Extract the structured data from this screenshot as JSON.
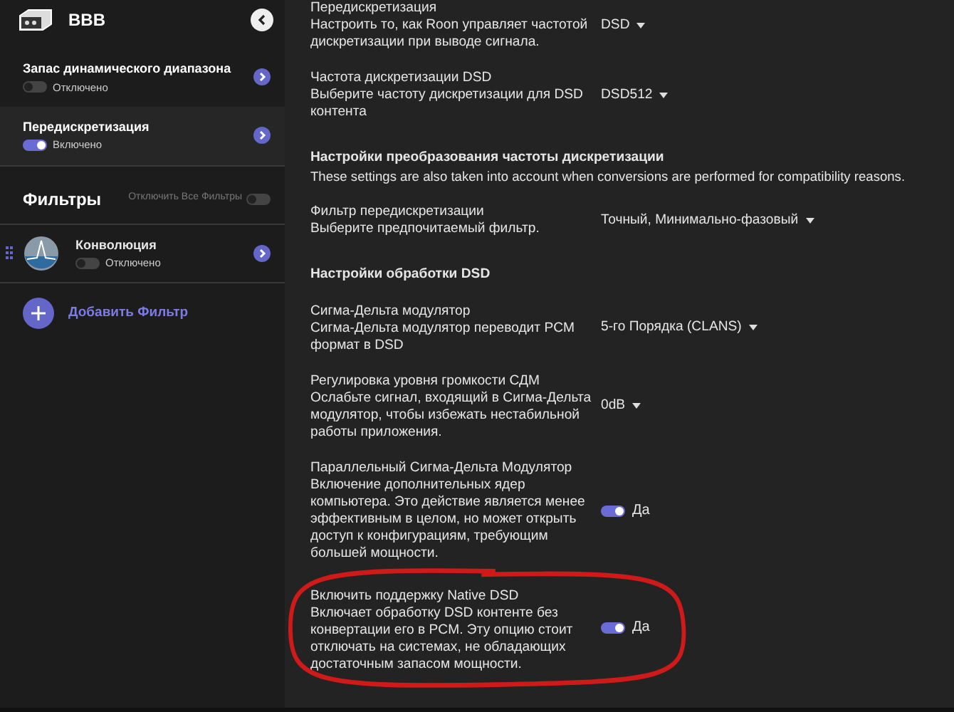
{
  "sidebar": {
    "device": {
      "title": "BBB"
    },
    "items": [
      {
        "title": "Запас динамического диапазона",
        "status": "Отключено",
        "on": false,
        "selected": false
      },
      {
        "title": "Передискретизация",
        "status": "Включено",
        "on": true,
        "selected": true
      }
    ],
    "filters": {
      "heading": "Фильтры",
      "disable_all_label": "Отключить Все Фильтры",
      "disable_all_on": false,
      "items": [
        {
          "title": "Конволюция",
          "status": "Отключено",
          "on": false
        }
      ],
      "add_label": "Добавить Фильтр"
    }
  },
  "settings": [
    {
      "kind": "select",
      "title": "Передискретизация",
      "description": "Настроить то, как Roon управляет частотой дискретизации при выводе сигнала.",
      "value": "DSD",
      "highlighted": false
    },
    {
      "kind": "select",
      "title": "Частота дискретизации DSD",
      "description": "Выберите частоту дискретизации для DSD контента",
      "value": "DSD512",
      "highlighted": false
    },
    {
      "kind": "section",
      "title": "Настройки преобразования частоты дискретизации",
      "description": "These settings are also taken into account when conversions are performed for compatibility reasons."
    },
    {
      "kind": "select",
      "title": "Фильтр передискретизации",
      "description": "Выберите предпочитаемый фильтр.",
      "value": "Точный, Минимально-фазовый",
      "highlighted": false
    },
    {
      "kind": "section",
      "title": "Настройки обработки DSD"
    },
    {
      "kind": "select",
      "title": "Сигма-Дельта модулятор",
      "description": "Сигма-Дельта модулятор переводит PCM формат в DSD",
      "value": "5-го Порядка (CLANS)",
      "highlighted": false
    },
    {
      "kind": "select",
      "title": "Регулировка уровня громкости СДМ",
      "description": "Ослабьте сигнал, входящий в Сигма-Дельта модулятор, чтобы избежать нестабильной работы приложения.",
      "value": "0dB",
      "highlighted": false
    },
    {
      "kind": "toggle",
      "title": "Параллельный Сигма-Дельта Модулятор",
      "description": "Включение дополнительных ядер компьютера. Это действие является менее эффективным в целом, но может открыть доступ  к конфигурациям, требующим большей мощности.",
      "on": true,
      "value": "Да",
      "highlighted": false
    },
    {
      "kind": "toggle",
      "title": "Включить поддержку Native DSD",
      "description": "Включает обработку DSD контенте без конвертации его в PCM. Эту опцию стоит отключать на системах, не обладающих достаточным запасом мощности.",
      "on": true,
      "value": "Да",
      "highlighted": true
    }
  ]
}
